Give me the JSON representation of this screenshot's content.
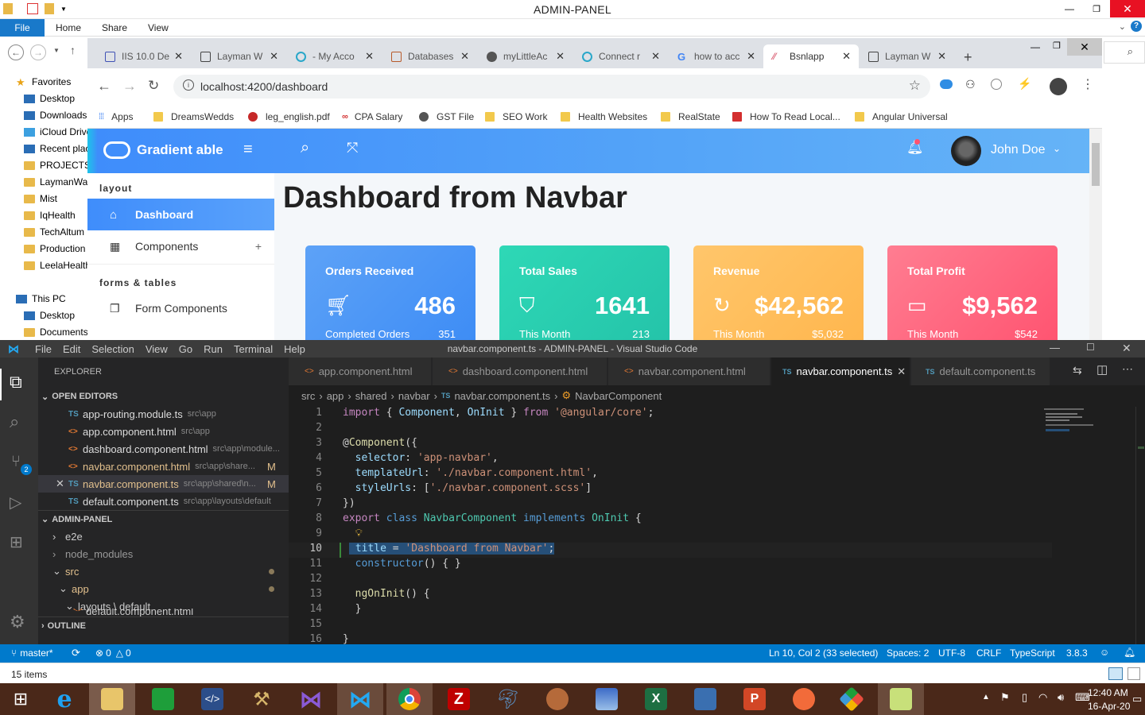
{
  "explorer": {
    "title": "ADMIN-PANEL",
    "ribbon": {
      "file": "File",
      "tabs": [
        "Home",
        "Share",
        "View"
      ]
    },
    "nav_items": [
      "Favorites",
      "Desktop",
      "Downloads",
      "iCloud Drive",
      "Recent places",
      "PROJECTS",
      "LaymanWays",
      "Mist",
      "IqHealth",
      "TechAltum",
      "Production",
      "LeelaHealth",
      "This PC",
      "Desktop",
      "Documents"
    ],
    "status_items": "15 items"
  },
  "chrome": {
    "tabs": [
      {
        "label": "IIS 10.0 De",
        "color": "#3f51b5"
      },
      {
        "label": "Layman W",
        "color": "#444444"
      },
      {
        "label": "- My Acco",
        "color": "#2aa7c9"
      },
      {
        "label": "Databases",
        "color": "#b75a2b"
      },
      {
        "label": "myLittleAc",
        "color": "#555555"
      },
      {
        "label": "Connect r",
        "color": "#2aa7c9"
      },
      {
        "label": "how to acc",
        "color": "#4285f4"
      },
      {
        "label": "Bsnlapp",
        "color": "#d23f57"
      },
      {
        "label": "Layman W",
        "color": "#444444"
      }
    ],
    "url": "localhost:4200/dashboard",
    "bookmarks": [
      "Apps",
      "DreamsWedds",
      "leg_english.pdf",
      "CPA Salary",
      "GST File",
      "SEO Work",
      "Health Websites",
      "RealState",
      "How To Read Local...",
      "Angular Universal"
    ]
  },
  "app": {
    "brand": "Gradient able",
    "user": "John Doe",
    "heading": "Dashboard from Navbar",
    "sidebar": {
      "group1": "layout",
      "dashboard": "Dashboard",
      "components": "Components",
      "group2": "forms & tables",
      "form_components": "Form Components"
    },
    "cards": [
      {
        "title": "Orders Received",
        "value": "486",
        "sub": "Completed Orders",
        "num": "351",
        "color1": "#5da2f7",
        "color2": "#3d8cf5"
      },
      {
        "title": "Total Sales",
        "value": "1641",
        "sub": "This Month",
        "num": "213",
        "color1": "#2ed8b6",
        "color2": "#24c3a9"
      },
      {
        "title": "Revenue",
        "value": "$42,562",
        "sub": "This Month",
        "num": "$5,032",
        "color1": "#ffc66b",
        "color2": "#ffb64d"
      },
      {
        "title": "Total Profit",
        "value": "$9,562",
        "sub": "This Month",
        "num": "$542",
        "color1": "#ff7d91",
        "color2": "#ff5370"
      }
    ]
  },
  "vscode": {
    "menu": [
      "File",
      "Edit",
      "Selection",
      "View",
      "Go",
      "Run",
      "Terminal",
      "Help"
    ],
    "title": "navbar.component.ts - ADMIN-PANEL - Visual Studio Code",
    "explorer_label": "EXPLORER",
    "open_editors_label": "OPEN EDITORS",
    "open_editors": [
      {
        "icon": "TS",
        "name": "app-routing.module.ts",
        "path": "src\\app",
        "mod": ""
      },
      {
        "icon": "<>",
        "name": "app.component.html",
        "path": "src\\app",
        "mod": ""
      },
      {
        "icon": "<>",
        "name": "dashboard.component.html",
        "path": "src\\app\\module...",
        "mod": ""
      },
      {
        "icon": "<>",
        "name": "navbar.component.html",
        "path": "src\\app\\share...",
        "mod": "M"
      },
      {
        "icon": "TS",
        "name": "navbar.component.ts",
        "path": "src\\app\\shared\\n...",
        "mod": "M"
      },
      {
        "icon": "TS",
        "name": "default.component.ts",
        "path": "src\\app\\layouts\\default",
        "mod": ""
      }
    ],
    "project_label": "ADMIN-PANEL",
    "tree": [
      "e2e",
      "node_modules",
      "src",
      "app",
      "layouts \\ default",
      "default.component.html"
    ],
    "outline_label": "OUTLINE",
    "tabs": [
      "app.component.html",
      "dashboard.component.html",
      "navbar.component.html",
      "navbar.component.ts",
      "default.component.ts"
    ],
    "breadcrumb": [
      "src",
      "app",
      "shared",
      "navbar",
      "navbar.component.ts",
      "NavbarComponent"
    ],
    "line_numbers": [
      "1",
      "2",
      "3",
      "4",
      "5",
      "6",
      "7",
      "8",
      "9",
      "10",
      "11",
      "12",
      "13",
      "14",
      "15",
      "16"
    ],
    "status": {
      "branch": "master*",
      "problems": "0",
      "warnings": "0",
      "position": "Ln 10, Col 2 (33 selected)",
      "spaces": "Spaces: 2",
      "encoding": "UTF-8",
      "eol": "CRLF",
      "language": "TypeScript",
      "version": "3.8.3"
    }
  },
  "taskbar": {
    "time": "12:40 AM",
    "date": "16-Apr-20",
    "apps": [
      "ie",
      "file-explorer",
      "store",
      "dev-tool",
      "tools",
      "visual-studio",
      "vscode",
      "chrome",
      "filezilla",
      "mysql-workbench",
      "wireshark",
      "server",
      "excel",
      "network",
      "powerpoint",
      "postman",
      "git",
      "notepad"
    ]
  }
}
